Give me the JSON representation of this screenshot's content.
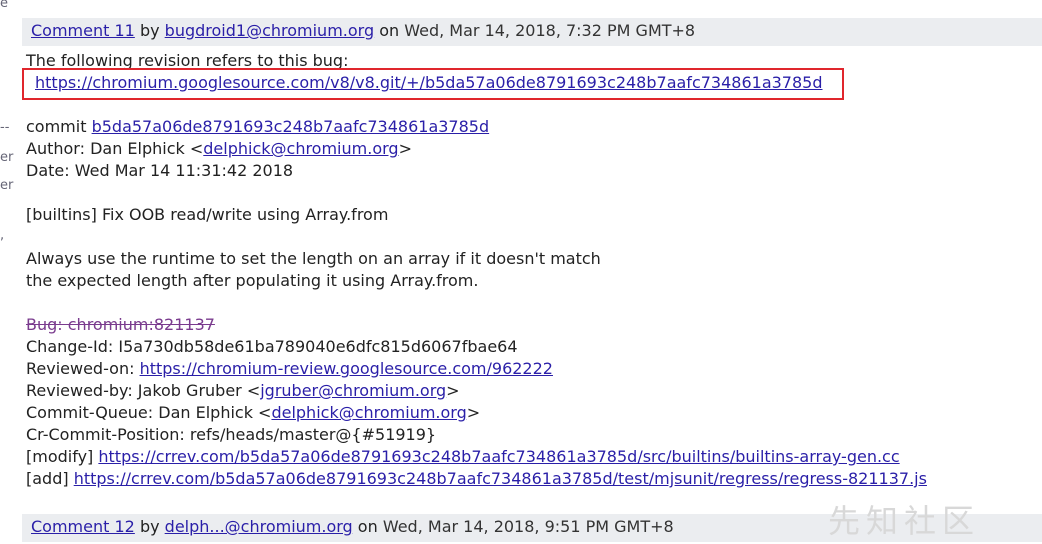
{
  "sidebar": {
    "glyphs": [
      "e",
      "--",
      "er",
      "er",
      ","
    ]
  },
  "comment11": {
    "link": "Comment 11",
    "by": "by",
    "author": "bugdroid1@chromium.org",
    "on": "on",
    "date": "Wed, Mar 14, 2018, 7:32 PM GMT+8"
  },
  "revision": {
    "intro": "The following revision refers to this bug:",
    "url": "https://chromium.googlesource.com/v8/v8.git/+/b5da57a06de8791693c248b7aafc734861a3785d"
  },
  "commit": {
    "commit_label": "commit",
    "hash": "b5da57a06de8791693c248b7aafc734861a3785d",
    "author_label": "Author: Dan Elphick <",
    "author_email": "delphick@chromium.org",
    "author_close": ">",
    "date": "Date: Wed Mar 14 11:31:42 2018",
    "title": "[builtins] Fix OOB read/write using Array.from",
    "desc1": "Always use the runtime to set the length on an array if it doesn't match",
    "desc2": "the expected length after populating it using Array.from.",
    "bug": "Bug: chromium:821137",
    "change_id": "Change-Id: I5a730db58de61ba789040e6dfc815d6067fbae64",
    "reviewed_on_label": "Reviewed-on: ",
    "reviewed_on_url": "https://chromium-review.googlesource.com/962222",
    "reviewed_by_label": "Reviewed-by: Jakob Gruber <",
    "reviewed_by_email": "jgruber@chromium.org",
    "reviewed_by_close": ">",
    "queue_label": "Commit-Queue: Dan Elphick <",
    "queue_email": "delphick@chromium.org",
    "queue_close": ">",
    "position": "Cr-Commit-Position: refs/heads/master@{#51919}",
    "modify_label": "[modify] ",
    "modify_url": "https://crrev.com/b5da57a06de8791693c248b7aafc734861a3785d/src/builtins/builtins-array-gen.cc",
    "add_label": "[add] ",
    "add_url": "https://crrev.com/b5da57a06de8791693c248b7aafc734861a3785d/test/mjsunit/regress/regress-821137.js"
  },
  "comment12": {
    "link": "Comment 12",
    "by": "by",
    "author": "delph...@chromium.org",
    "on": "on",
    "date": "Wed, Mar 14, 2018, 9:51 PM GMT+8"
  },
  "watermark": {
    "text": "先知社区"
  },
  "colors": {
    "link": "#2a1fa8",
    "highlight_border": "#e0262d",
    "header_bg": "#ebedf0"
  }
}
